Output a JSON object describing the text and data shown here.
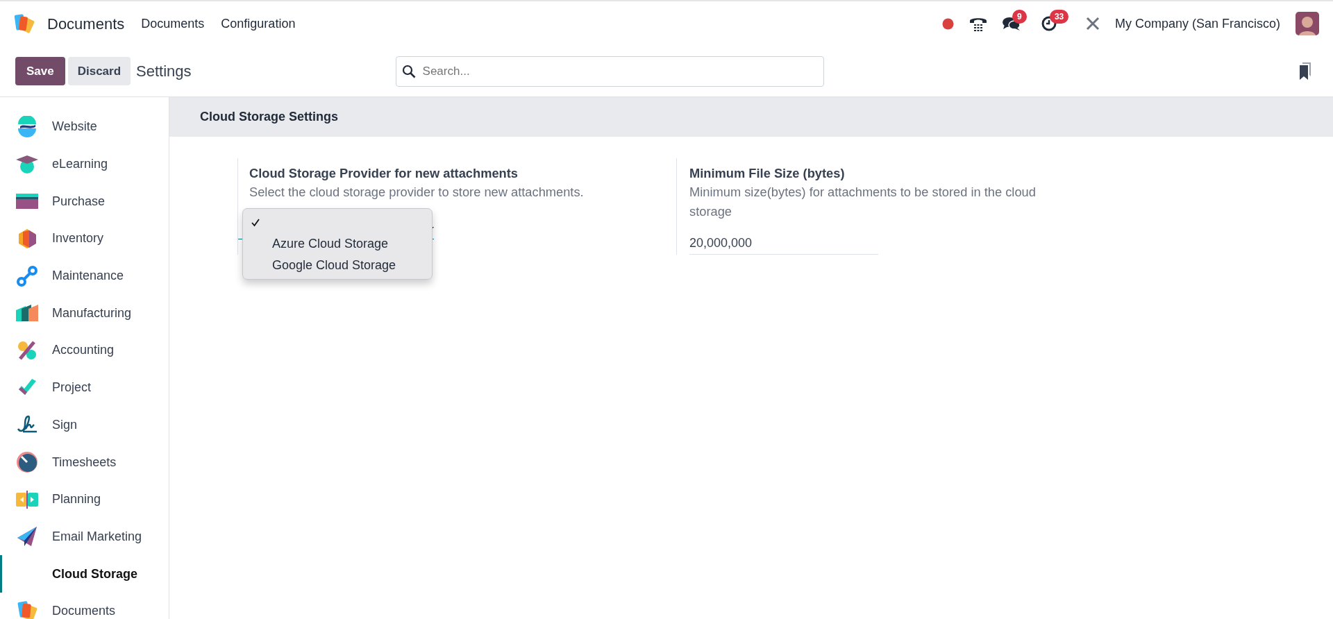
{
  "navbar": {
    "app_name": "Documents",
    "menus": [
      "Documents",
      "Configuration"
    ],
    "messages_badge": "9",
    "activities_badge": "33",
    "company": "My Company (San Francisco)"
  },
  "control_panel": {
    "save": "Save",
    "discard": "Discard",
    "breadcrumb": "Settings",
    "search": {
      "placeholder": "Search..."
    }
  },
  "sidebar": {
    "items": [
      {
        "label": "Website",
        "selected": false
      },
      {
        "label": "eLearning",
        "selected": false
      },
      {
        "label": "Purchase",
        "selected": false
      },
      {
        "label": "Inventory",
        "selected": false
      },
      {
        "label": "Maintenance",
        "selected": false
      },
      {
        "label": "Manufacturing",
        "selected": false
      },
      {
        "label": "Accounting",
        "selected": false
      },
      {
        "label": "Project",
        "selected": false
      },
      {
        "label": "Sign",
        "selected": false
      },
      {
        "label": "Timesheets",
        "selected": false
      },
      {
        "label": "Planning",
        "selected": false
      },
      {
        "label": "Email Marketing",
        "selected": false
      },
      {
        "label": "Cloud Storage",
        "selected": true
      },
      {
        "label": "Documents",
        "selected": false
      }
    ]
  },
  "section": {
    "title": "Cloud Storage Settings",
    "settings": [
      {
        "kind": "select",
        "title": "Cloud Storage Provider for new attachments",
        "description": "Select the cloud storage provider to store new attachments.",
        "options": [
          {
            "selected": true
          },
          {
            "label": "Azure Cloud Storage",
            "selected": false
          },
          {
            "label": "Google Cloud Storage",
            "selected": false
          }
        ]
      },
      {
        "kind": "input",
        "title": "Minimum File Size (bytes)",
        "description": "Minimum size(bytes) for attachments to be stored in the cloud storage",
        "value": "20,000,000"
      }
    ]
  }
}
